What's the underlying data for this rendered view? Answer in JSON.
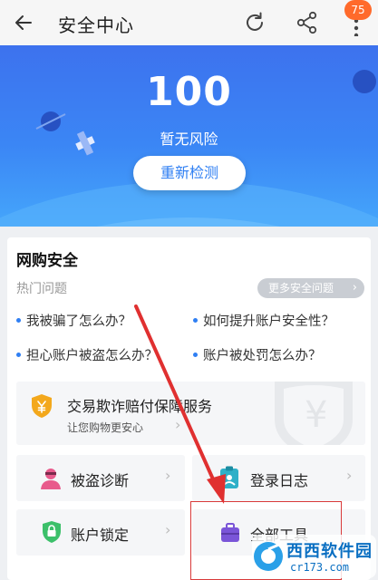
{
  "header": {
    "title": "安全中心",
    "badge_count": "75",
    "icons": [
      "back-arrow-icon",
      "refresh-icon",
      "share-icon",
      "more-vertical-icon"
    ]
  },
  "hero": {
    "score": "100",
    "status": "暂无风险",
    "recheck_label": "重新检测"
  },
  "section": {
    "title": "网购安全",
    "hot_label": "热门问题",
    "more_label": "更多安全问题",
    "questions": [
      "我被骗了怎么办？",
      "如何提升账户安全性？",
      "担心账户被盗怎么办？",
      "账户被处罚怎么办？"
    ],
    "protection": {
      "title": "交易欺诈赔付保障服务",
      "subtitle": "让您购物更安心",
      "watermark": "¥"
    },
    "tools": [
      {
        "label": "被盗诊断",
        "icon": "person-icon"
      },
      {
        "label": "登录日志",
        "icon": "clipboard-icon"
      },
      {
        "label": "账户锁定",
        "icon": "lock-icon"
      },
      {
        "label": "全部工具",
        "icon": "toolbox-icon"
      }
    ]
  },
  "watermark": {
    "text_main": "西西软件园",
    "text_url": "cr173.com"
  },
  "colors": {
    "accent": "#2f7ff3",
    "badge": "#ff6a2b",
    "highlight_box": "#d93a3a",
    "arrow": "#e03030"
  }
}
